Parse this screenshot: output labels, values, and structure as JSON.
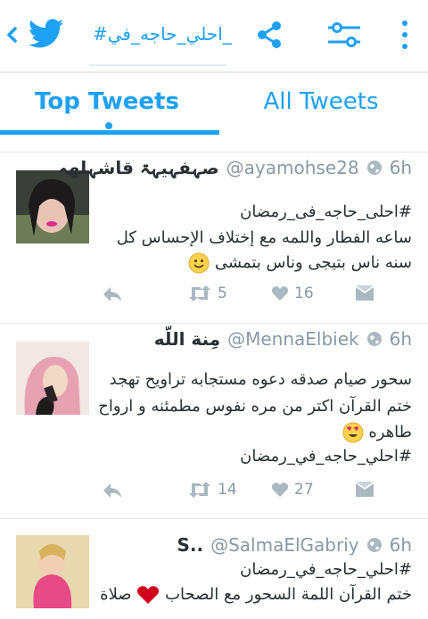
{
  "header": {
    "search_query": "#احلي_حاجه_في_",
    "icons": [
      "chevron-left-icon",
      "twitter-bird-icon",
      "share-icon",
      "filter-sliders-icon",
      "more-vertical-icon"
    ]
  },
  "tabs": [
    {
      "label": "Top Tweets",
      "selected": true
    },
    {
      "label": "All Tweets",
      "selected": false
    }
  ],
  "tweets": [
    {
      "name": "صہفہيہۃ قاشہلهہ",
      "handle": "@ayamohse28",
      "time": "6h",
      "lines": [
        "#احلى_حاجه_فى_رمضان",
        "ساعه الفطار واللمه مع إختلاف الإحساس كل",
        "سنه ناس بتيجى وناس بتمشى"
      ],
      "emoji": "slightly-smiling-face",
      "retweets": "5",
      "likes": "16"
    },
    {
      "name": "مِنة اللّه",
      "handle": "@MennaElbiek",
      "time": "6h",
      "lines": [
        "سحور صيام صدقه دعوه مستجابه تراويح تهجد",
        "ختم القرآن اكتر من مره نفوس مطمئنه و ارواح",
        "طاهره",
        "#احلي_حاجه_في_رمضان"
      ],
      "emoji": "heart-eyes-face",
      "retweets": "14",
      "likes": "27"
    },
    {
      "name": "S..",
      "handle": "@SalmaElGabriy",
      "time": "6h",
      "lines": [
        "#احلي_حاجه_في_رمضان",
        "ختم القرآن اللمة السحور مع الصحاب",
        "صلاة"
      ],
      "emoji": "red-heart"
    }
  ],
  "colors": {
    "accent": "#1da1f2",
    "muted": "#8899a6",
    "text": "#292f33",
    "divider": "#e1e8ed"
  }
}
